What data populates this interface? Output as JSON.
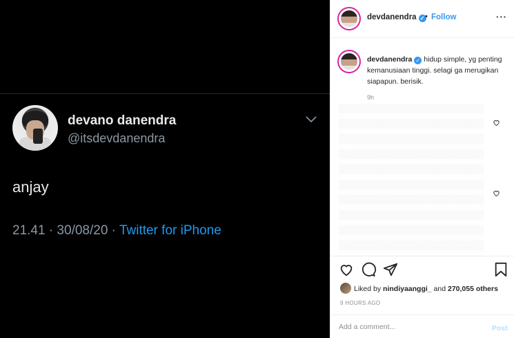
{
  "tweet": {
    "display_name": "devano danendra",
    "handle": "@itsdevdanendra",
    "text": "anjay",
    "meta_time": "21.41 · 30/08/20 · ",
    "meta_source": "Twitter for iPhone"
  },
  "post": {
    "username": "devdanendra",
    "verified_mark": "✓",
    "dot": "•",
    "follow_label": "Follow",
    "more_label": "···",
    "caption_username": "devdanendra",
    "caption_text": "hidup simple, yg penting kemanusiaan tinggi. selagi ga merugikan siapapun. berisik.",
    "caption_time": "9h",
    "liked_prefix": "Liked by ",
    "liked_user": "nindiyaanggi_",
    "liked_and": " and ",
    "liked_count": "270,055 others",
    "time_ago": "9 HOURS AGO",
    "comment_placeholder": "Add a comment...",
    "post_label": "Post"
  },
  "icons": [
    "chevron-down-icon",
    "verified-icon",
    "more-icon",
    "heart-icon",
    "comment-icon",
    "share-icon",
    "bookmark-icon"
  ],
  "colors": {
    "twitter_blue": "#1d9bf0",
    "ig_link": "#3897f0",
    "post_disabled": "#b2dffc"
  }
}
